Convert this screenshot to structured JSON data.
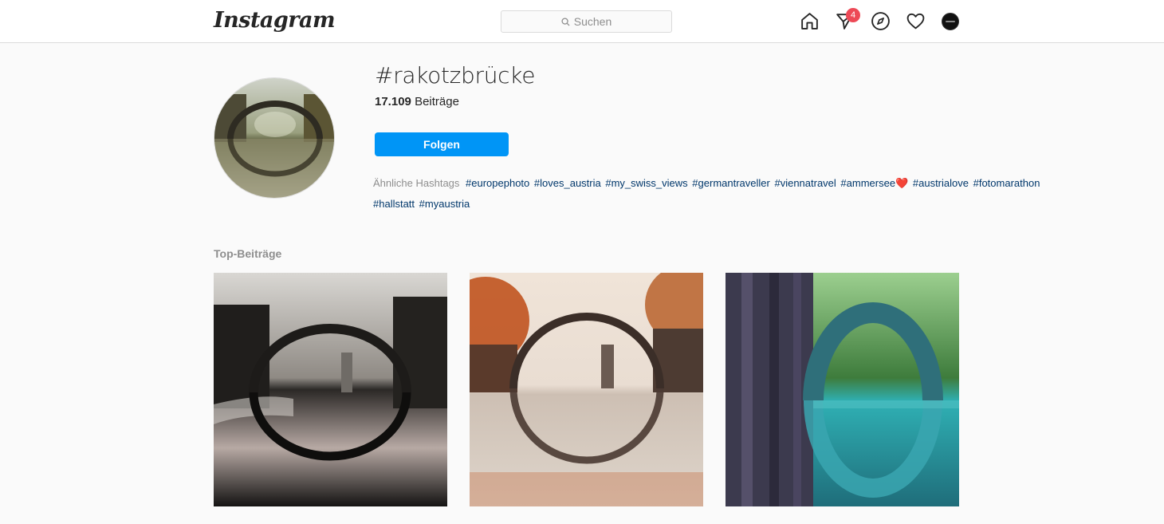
{
  "header": {
    "logo": "Instagram",
    "search_placeholder": "Suchen",
    "nav_icons": [
      "home-icon",
      "direct-message-icon",
      "explore-icon",
      "activity-heart-icon",
      "profile-avatar"
    ],
    "notification_count": "4"
  },
  "hashtag": {
    "name": "#rakotzbrücke",
    "post_count": "17.109",
    "post_label": "Beiträge",
    "follow_label": "Folgen"
  },
  "related": {
    "label": "Ähnliche Hashtags",
    "tags": [
      "#europephoto",
      "#loves_austria",
      "#my_swiss_views",
      "#germantraveller",
      "#viennatravel",
      "#ammersee❤️",
      "#austrialove",
      "#fotomarathon",
      "#hallstatt",
      "#myaustria"
    ]
  },
  "top_posts": {
    "title": "Top-Beiträge",
    "posts": [
      {
        "theme": "dark-winter"
      },
      {
        "theme": "autumn-mist"
      },
      {
        "theme": "teal-basalt"
      }
    ]
  },
  "colors": {
    "accent": "#0095f6",
    "badge": "#ed4956",
    "link": "#00376b"
  }
}
